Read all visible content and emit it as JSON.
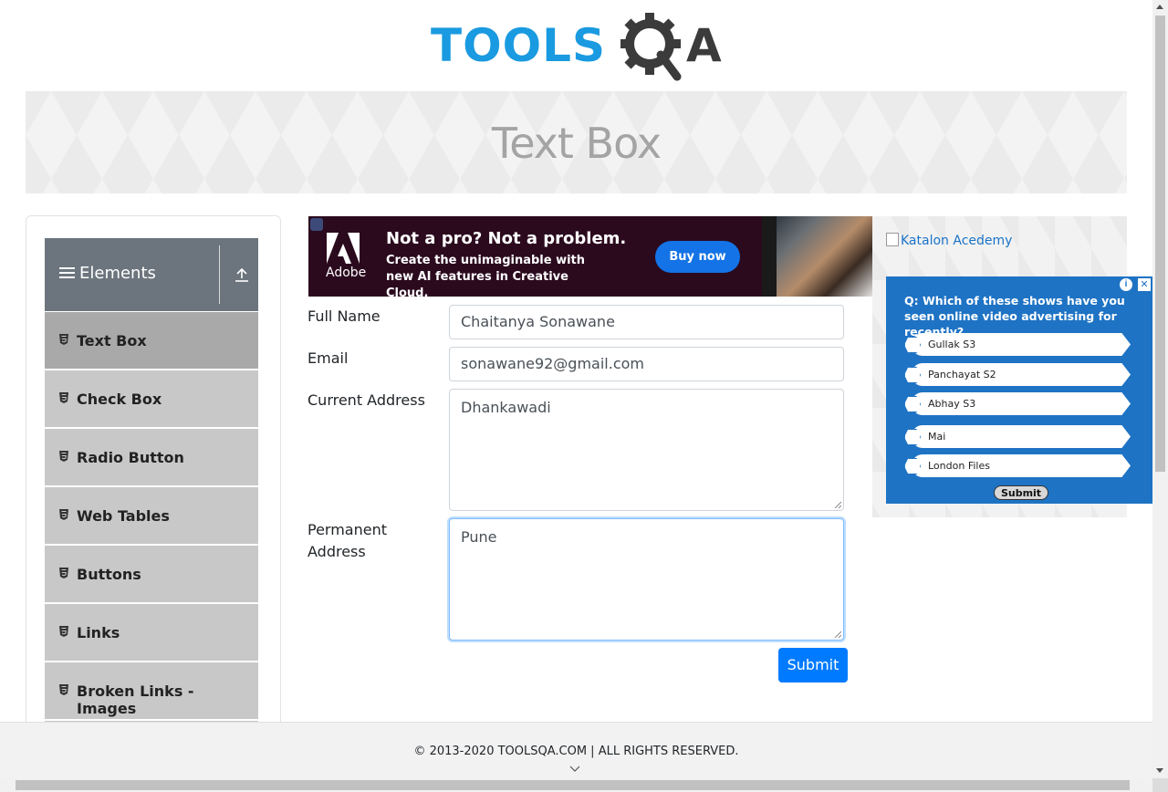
{
  "logo": {
    "text_tools": "TOOLS",
    "text_a": "A",
    "colors": {
      "blue": "#1a9ae0",
      "dark": "#3b3b3b"
    }
  },
  "banner": {
    "title": "Text Box"
  },
  "sidebar": {
    "group_title": "Elements",
    "items": [
      {
        "label": "Text Box",
        "active": true
      },
      {
        "label": "Check Box"
      },
      {
        "label": "Radio Button"
      },
      {
        "label": "Web Tables"
      },
      {
        "label": "Buttons"
      },
      {
        "label": "Links"
      },
      {
        "label": "Broken Links - Images"
      }
    ]
  },
  "ad_top": {
    "brand": "Adobe",
    "headline": "Not a pro? Not a problem.",
    "subtext": "Create the unimaginable with new AI features in Creative Cloud.",
    "button": "Buy now"
  },
  "form": {
    "full_name": {
      "label": "Full Name",
      "value": "Chaitanya Sonawane"
    },
    "email": {
      "label": "Email",
      "value": "sonawane92@gmail.com"
    },
    "current_address": {
      "label": "Current Address",
      "value": "Dhankawadi"
    },
    "permanent_address": {
      "label": "Permanent Address",
      "value": "Pune"
    },
    "submit": "Submit"
  },
  "ad_right": {
    "image_alt": "Katalon Acedemy",
    "survey": {
      "question": "Q:  Which of these shows have you seen online video advertising for recently?",
      "options": [
        "Gullak S3",
        "Panchayat S2",
        "Abhay S3",
        "Mai",
        "London Files"
      ],
      "submit": "Submit"
    }
  },
  "footer": {
    "copyright": "© 2013-2020 TOOLSQA.COM | ALL RIGHTS RESERVED."
  },
  "colors": {
    "primary": "#007bff",
    "group_header": "#6c757d",
    "menu_item": "#c8c8c8",
    "menu_active": "#a9a9a9"
  }
}
